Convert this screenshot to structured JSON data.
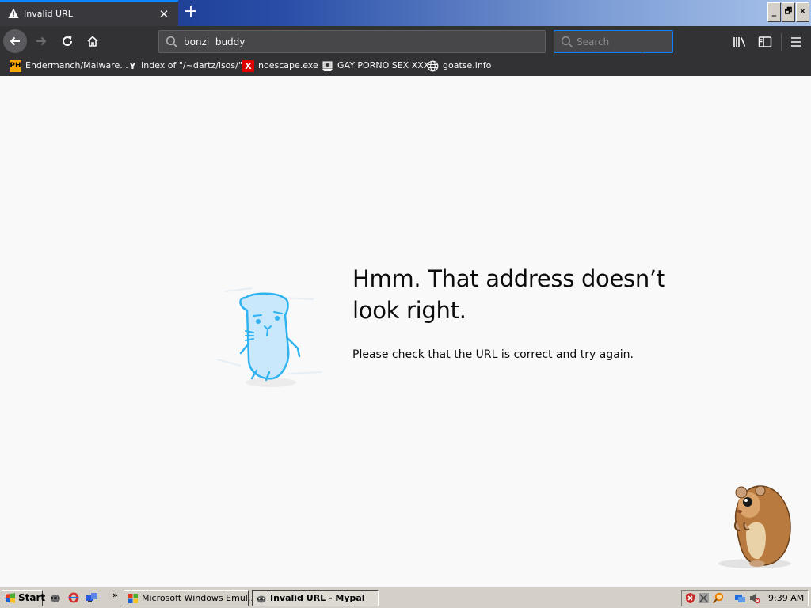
{
  "browser": {
    "tab": {
      "title": "Invalid URL",
      "close": "✕"
    },
    "new_tab": "+",
    "window_buttons": {
      "minimize": "_",
      "restore": "🗗",
      "close": "✕"
    },
    "url_value": "bonzi  buddy",
    "search_placeholder": "Search",
    "bookmarks": [
      {
        "icon": "PH",
        "label": "Endermanch/Malware..."
      },
      {
        "icon": "Y",
        "label": "Index of \"/~dartz/isos/\""
      },
      {
        "icon": "X",
        "label": "noescape.exe"
      },
      {
        "icon": "",
        "label": "GAY PORNO SEX XXX"
      },
      {
        "icon": "",
        "label": "goatse.info"
      }
    ]
  },
  "error_page": {
    "title": "Hmm. That address doesn’t look right.",
    "description": "Please check that the URL is correct and try again."
  },
  "taskbar": {
    "start_label": "Start",
    "chevron": "»",
    "tasks": [
      {
        "label": "Microsoft Windows Emul...",
        "active": false
      },
      {
        "label": "Invalid URL - Mypal",
        "active": true
      }
    ],
    "clock": "9:39 AM"
  },
  "colors": {
    "accent": "#0a84ff",
    "toolbar": "#323234",
    "content_bg": "#f9f9fa",
    "taskbar": "#d4d0c8"
  }
}
